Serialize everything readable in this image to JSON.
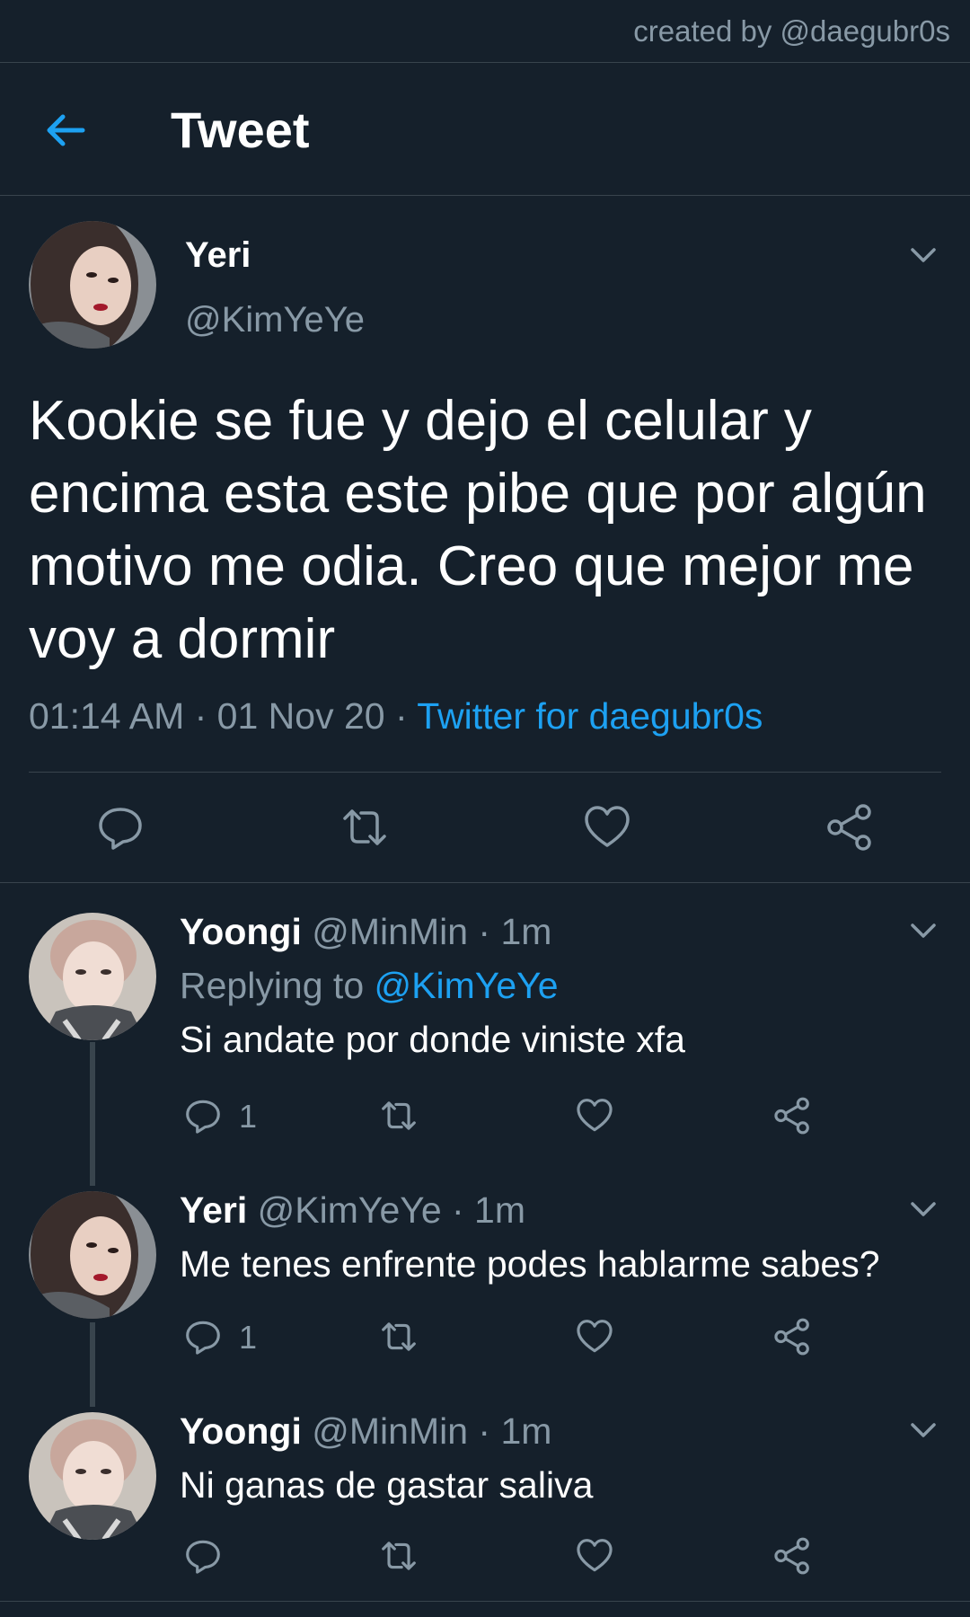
{
  "credit": "created by @daegubr0s",
  "header": {
    "title": "Tweet"
  },
  "main_tweet": {
    "name": "Yeri",
    "handle": "@KimYeYe",
    "text": "Kookie se fue y dejo el celular y encima esta este pibe que por algún motivo me odia. Creo que mejor me voy a dormir",
    "time": "01:14 AM · 01 Nov 20 · ",
    "source": "Twitter for daegubr0s"
  },
  "replies": [
    {
      "name": "Yoongi",
      "handle_time": " @MinMin · 1m",
      "replying_label": "Replying to ",
      "replying_to": "@KimYeYe",
      "text": "Si andate por donde viniste xfa",
      "reply_count": "1"
    },
    {
      "name": "Yeri",
      "handle_time": " @KimYeYe · 1m",
      "text": "Me tenes enfrente podes hablarme sabes?",
      "reply_count": "1"
    },
    {
      "name": "Yoongi",
      "handle_time": " @MinMin · 1m",
      "text": "Ni ganas de gastar saliva"
    }
  ],
  "colors": {
    "background": "#15202b",
    "accent": "#1da1f2",
    "secondary_text": "#8899a6",
    "divider": "#38444d"
  },
  "icons": [
    "back-arrow-icon",
    "chevron-down-icon",
    "reply-icon",
    "retweet-icon",
    "like-icon",
    "share-icon"
  ]
}
